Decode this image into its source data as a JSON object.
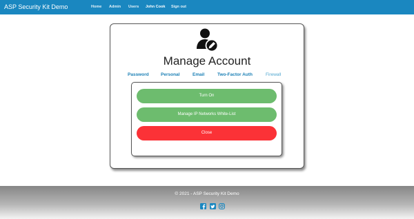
{
  "navbar": {
    "brand": "ASP Security Kit Demo",
    "links": [
      {
        "label": "Home"
      },
      {
        "label": "Admin"
      },
      {
        "label": "Users"
      },
      {
        "label": "John Cook"
      },
      {
        "label": "Sign out"
      }
    ],
    "color": "#1a87c0"
  },
  "account": {
    "icon": "user-edit-icon",
    "title": "Manage Account",
    "tabs": [
      {
        "label": "Password"
      },
      {
        "label": "Personal"
      },
      {
        "label": "Email"
      },
      {
        "label": "Two-Factor Auth"
      },
      {
        "label": "Firewall",
        "selected": true
      }
    ]
  },
  "firewall_panel": {
    "buttons": [
      {
        "label": "Turn On",
        "color": "#6dbc6e"
      },
      {
        "label": "Manage IP Networks White-List",
        "color": "#6dbc6e"
      },
      {
        "label": "Close",
        "color": "#fb3237"
      }
    ]
  },
  "footer": {
    "copyright": "© 2021 - ASP Security Kit Demo",
    "social_icons": [
      "facebook-icon",
      "twitter-icon",
      "instagram-icon"
    ]
  }
}
